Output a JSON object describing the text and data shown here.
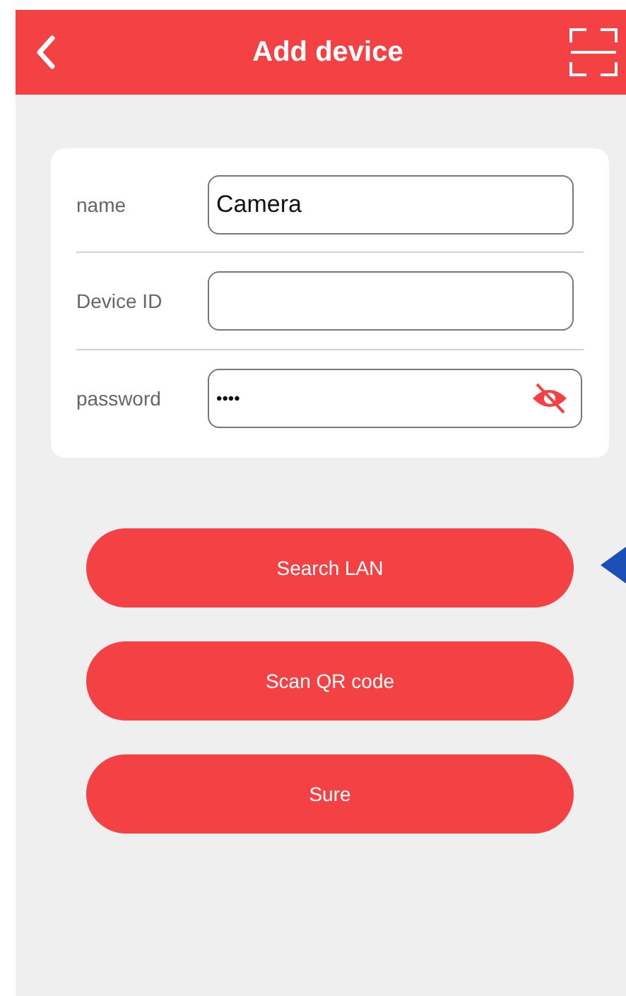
{
  "header": {
    "title": "Add device"
  },
  "fields": [
    {
      "label": "name",
      "value": "Camera",
      "kind": "text"
    },
    {
      "label": "Device ID",
      "kind": "text"
    },
    {
      "label": "password",
      "value": "••••",
      "kind": "password",
      "hidden": true
    }
  ],
  "buttons": [
    "Search LAN",
    "Scan QR code",
    "Sure"
  ]
}
